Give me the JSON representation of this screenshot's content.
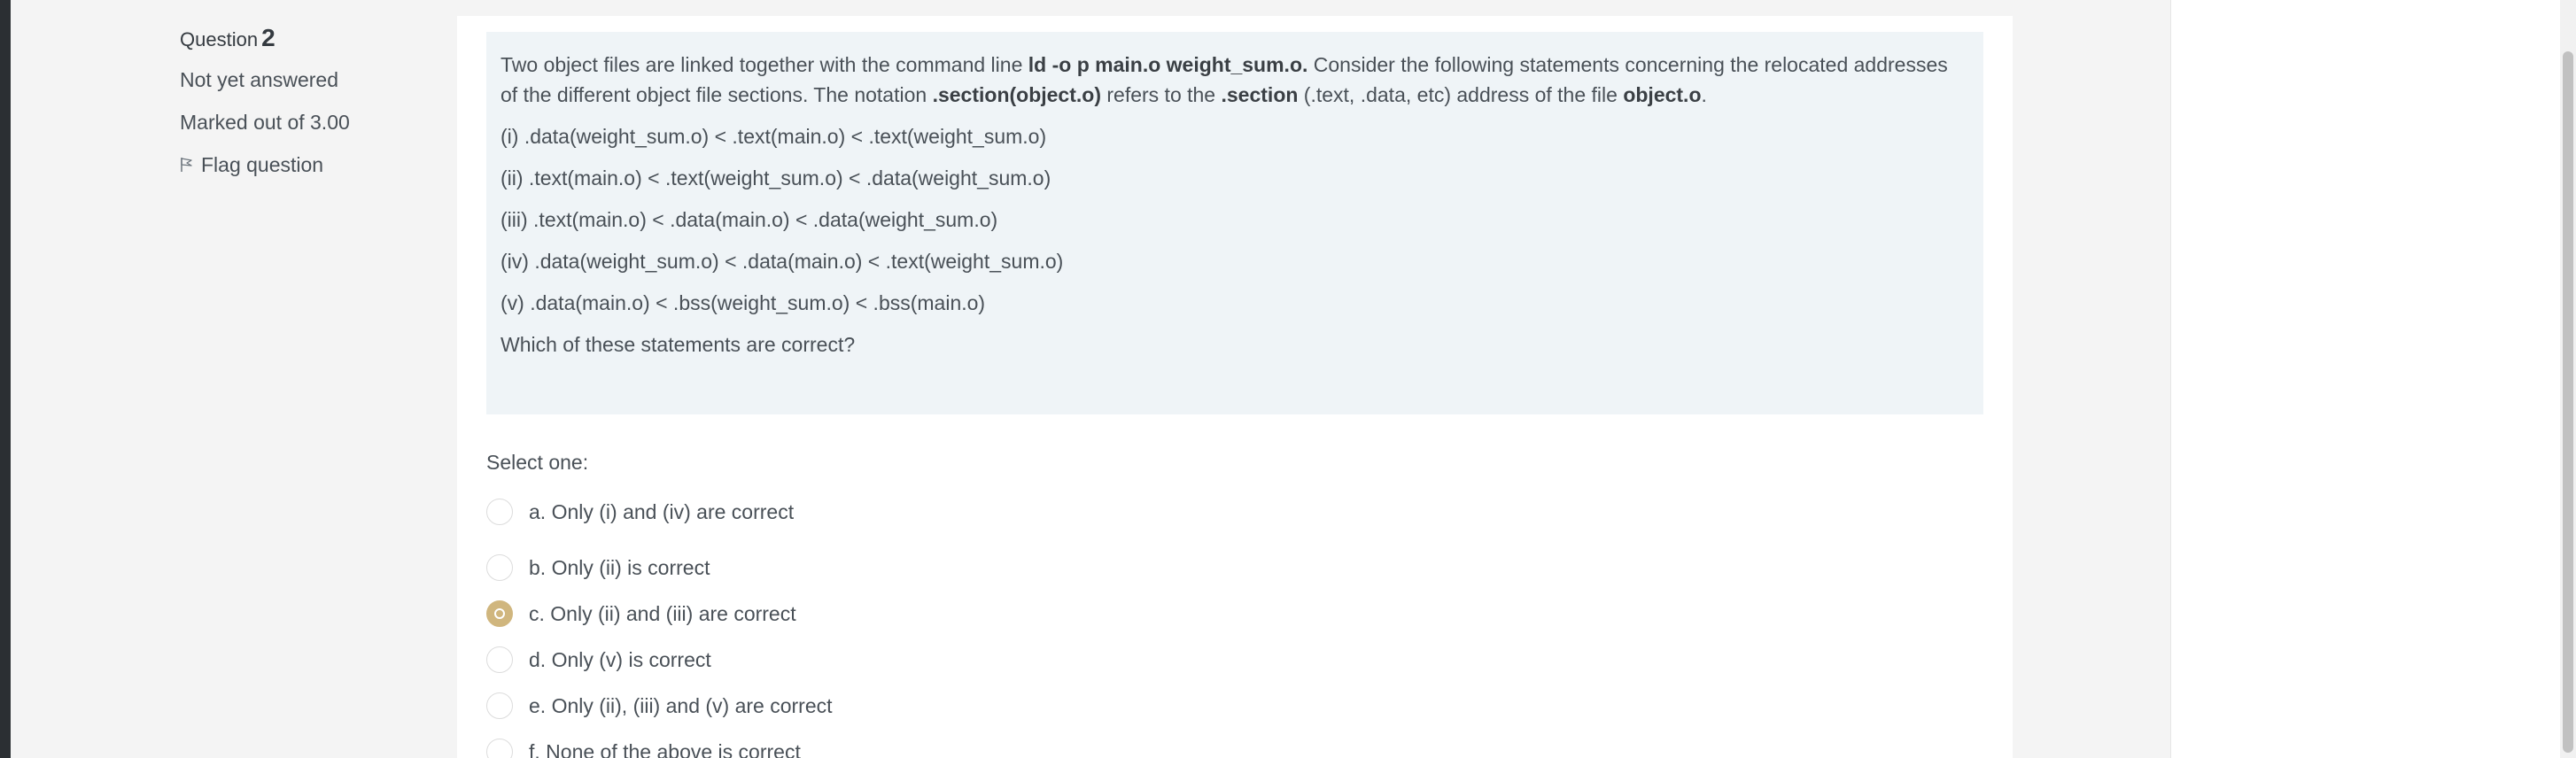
{
  "question_info": {
    "label": "Question",
    "number": "2",
    "status": "Not yet answered",
    "marks": "Marked out of 3.00",
    "flag_label": "Flag question"
  },
  "question_text": {
    "intro": {
      "t1": "Two object files are linked together with the command line ",
      "b1": "ld -o p main.o weight_sum.o.",
      "t2": " Consider the following statements concerning the relocated addresses of the different object file sections. The notation ",
      "b2": ".section(object.o)",
      "t3": " refers to the ",
      "b3": ".section",
      "t4": " (.text, .data, etc) address of the file ",
      "b4": "object.o",
      "t5": "."
    },
    "statements": [
      "(i) .data(weight_sum.o) < .text(main.o) < .text(weight_sum.o)",
      "(ii) .text(main.o) < .text(weight_sum.o) < .data(weight_sum.o)",
      "(iii) .text(main.o) < .data(main.o) < .data(weight_sum.o)",
      "(iv) .data(weight_sum.o) < .data(main.o) < .text(weight_sum.o)",
      "(v) .data(main.o) < .bss(weight_sum.o) < .bss(main.o)"
    ],
    "prompt": "Which of these statements are correct?"
  },
  "answer": {
    "select_label": "Select one:",
    "selected_index": 2,
    "options": [
      "a. Only (i) and (iv) are correct",
      "b. Only (ii) is correct",
      "c. Only (ii) and (iii) are correct",
      "d. Only (v) is correct",
      "e. Only (ii), (iii) and (v) are correct",
      "f. None of the above is correct"
    ]
  },
  "colors": {
    "selected_radio": "#d0b67e",
    "question_box": "#eff4f7",
    "sidebar": "#2b2f33"
  },
  "icons": {
    "flag": "flag-icon"
  }
}
